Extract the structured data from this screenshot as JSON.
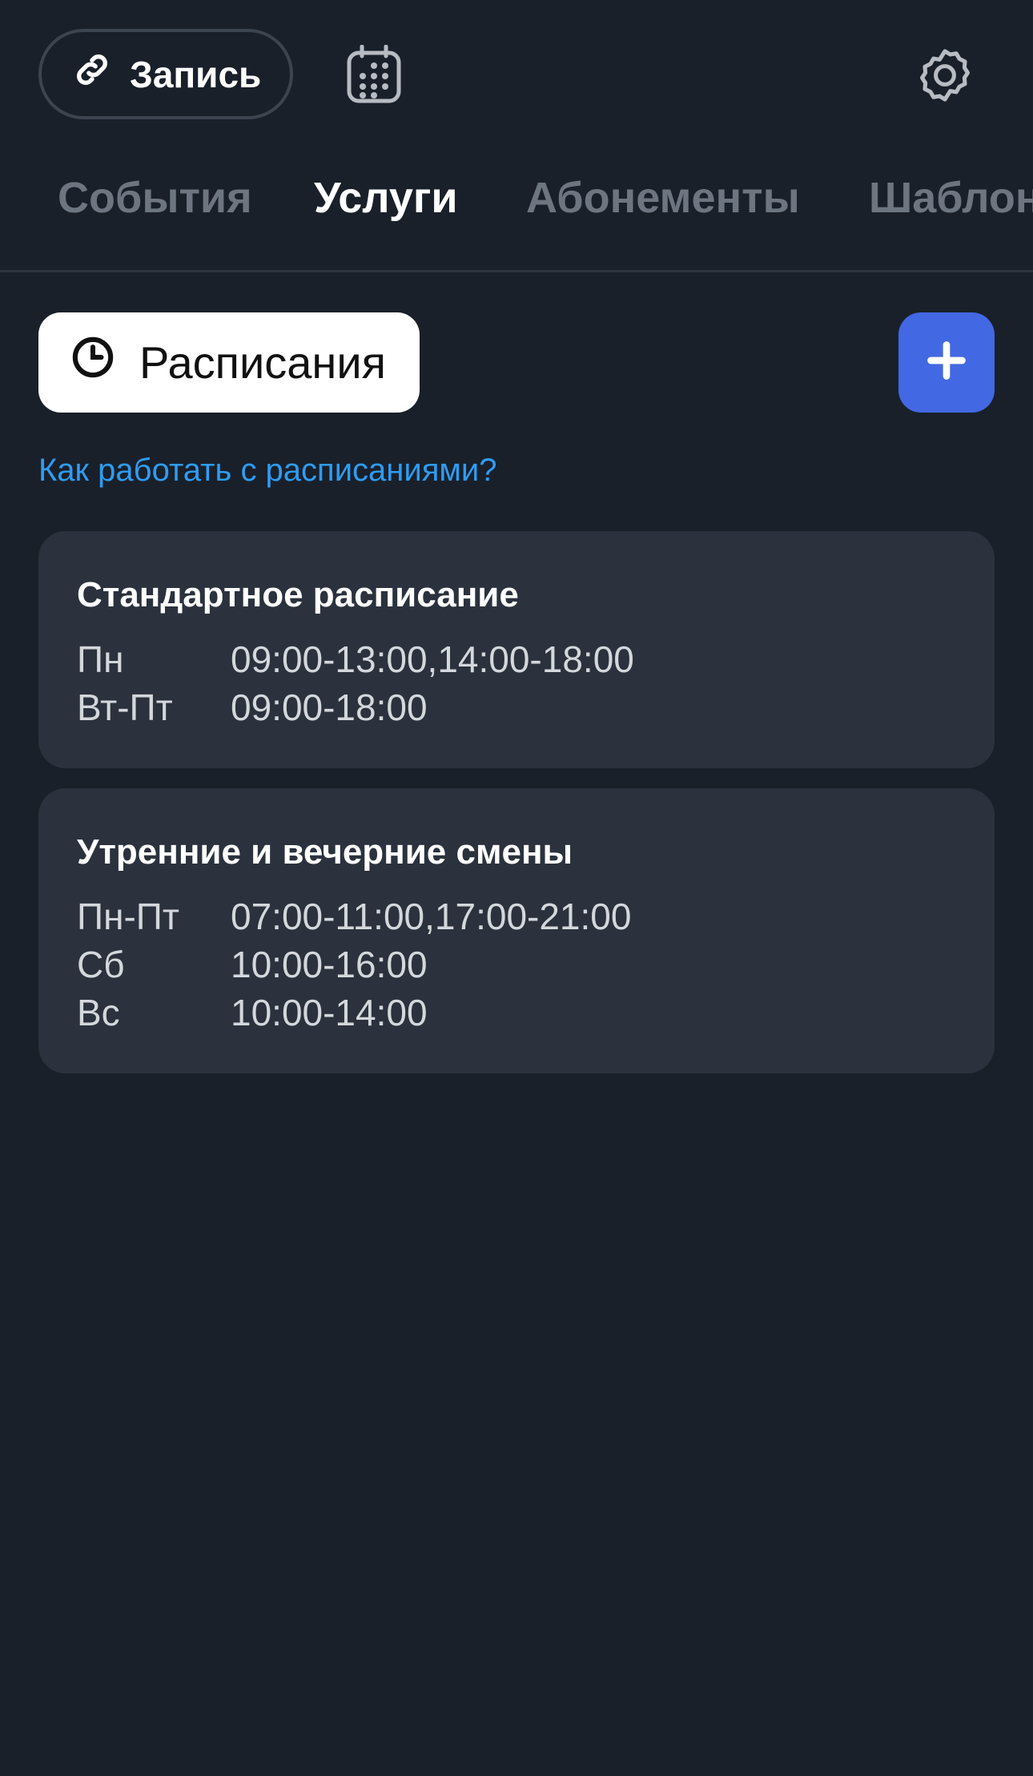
{
  "header": {
    "record_label": "Запись"
  },
  "tabs": [
    {
      "label": "События",
      "active": false
    },
    {
      "label": "Услуги",
      "active": true
    },
    {
      "label": "Абонементы",
      "active": false
    },
    {
      "label": "Шаблоны",
      "active": false
    }
  ],
  "toolbar": {
    "schedules_label": "Расписания",
    "add_symbol": "+"
  },
  "help_link": "Как работать с расписаниями?",
  "schedules": [
    {
      "title": "Стандартное расписание",
      "rows": [
        {
          "days": "Пн",
          "hours": "09:00-13:00,14:00-18:00"
        },
        {
          "days": "Вт-Пт",
          "hours": "09:00-18:00"
        }
      ]
    },
    {
      "title": "Утренние и вечерние смены",
      "rows": [
        {
          "days": "Пн-Пт",
          "hours": "07:00-11:00,17:00-21:00"
        },
        {
          "days": "Сб",
          "hours": "10:00-16:00"
        },
        {
          "days": "Вс",
          "hours": "10:00-14:00"
        }
      ]
    }
  ],
  "colors": {
    "background": "#19202a",
    "card": "#2b323d",
    "accent": "#4368e3",
    "link": "#2f9cf2",
    "tab_inactive": "#6d7580"
  }
}
